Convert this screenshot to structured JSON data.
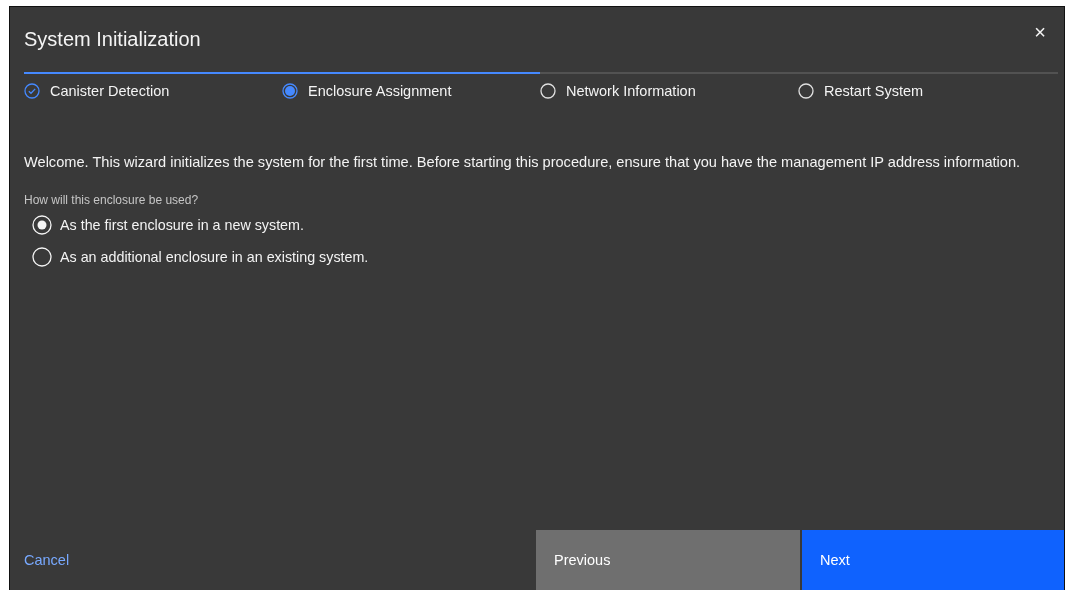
{
  "dialog": {
    "title": "System Initialization",
    "close": "×"
  },
  "steps": [
    {
      "label": "Canister Detection",
      "kind": "complete"
    },
    {
      "label": "Enclosure Assignment",
      "kind": "current"
    },
    {
      "label": "Network Information",
      "kind": "incomplete"
    },
    {
      "label": "Restart System",
      "kind": "incomplete"
    }
  ],
  "intro": "Welcome. This wizard initializes the system for the first time. Before starting this procedure, ensure that you have the management IP address information.",
  "question": "How will this enclosure be used?",
  "options": [
    {
      "label": "As the first enclosure in a new system.",
      "selected": true
    },
    {
      "label": "As an additional enclosure in an existing system.",
      "selected": false
    }
  ],
  "footer": {
    "cancel": "Cancel",
    "previous": "Previous",
    "next": "Next"
  }
}
